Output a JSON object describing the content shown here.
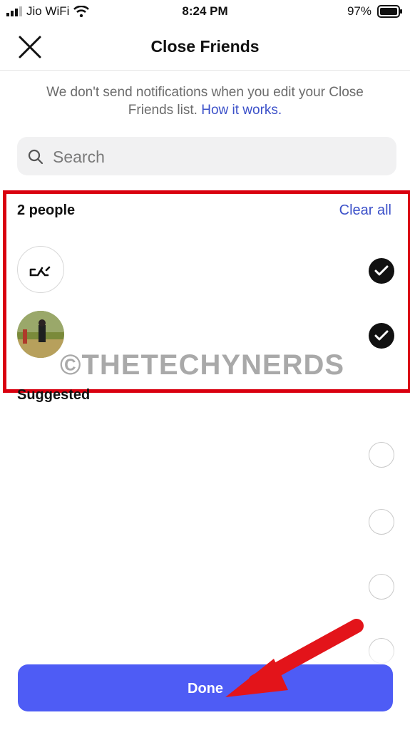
{
  "status_bar": {
    "carrier": "Jio WiFi",
    "time": "8:24 PM",
    "battery": "97%"
  },
  "header": {
    "title": "Close Friends",
    "close_icon": "close-icon"
  },
  "info": {
    "text": "We don't send notifications when you edit your Close Friends list.",
    "link": "How it works."
  },
  "search": {
    "placeholder": "Search",
    "value": ""
  },
  "selected": {
    "count_label": "2 people",
    "clear_label": "Clear all",
    "items": [
      {
        "avatar": "logo-avatar",
        "checked": true
      },
      {
        "avatar": "photo-avatar",
        "checked": true
      }
    ]
  },
  "watermark": "©THETECHYNERDS",
  "suggested": {
    "label": "Suggested",
    "items": [
      {
        "checked": false
      },
      {
        "checked": false
      },
      {
        "checked": false
      },
      {
        "checked": false
      }
    ]
  },
  "footer": {
    "done_label": "Done"
  },
  "colors": {
    "accent": "#4e5cf5",
    "link": "#3c51c9",
    "highlight": "#d9000f"
  }
}
